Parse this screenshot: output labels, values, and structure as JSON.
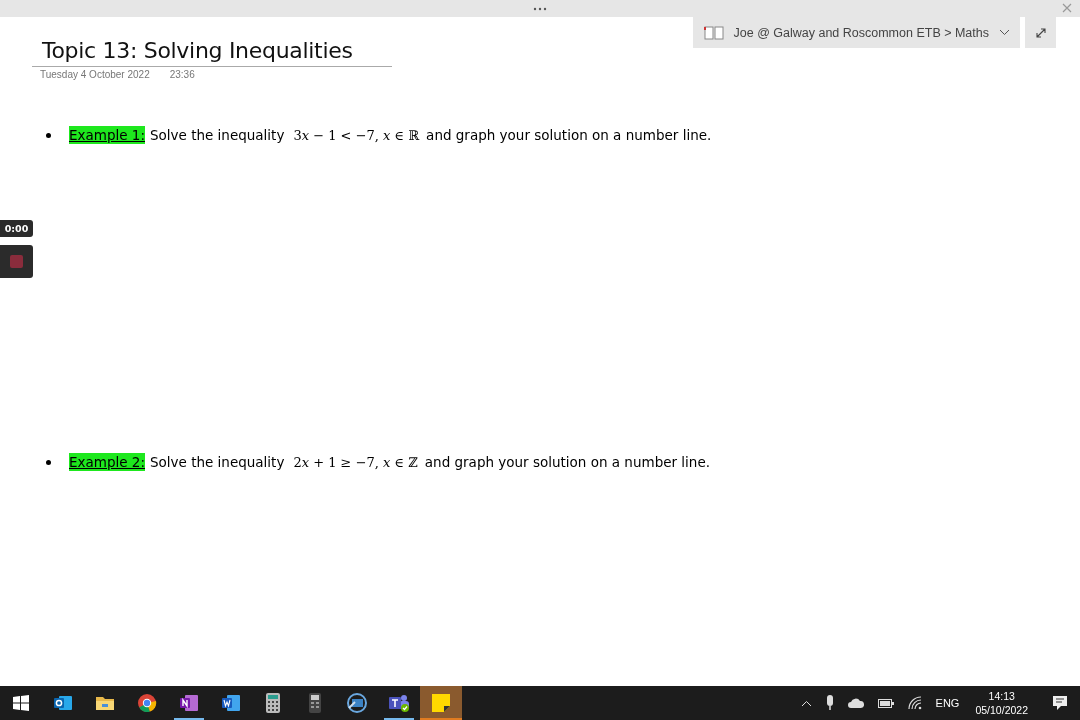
{
  "notebook_bar": {
    "path": "Joe @ Galway and Roscommon ETB > Maths"
  },
  "page": {
    "title": "Topic 13: Solving Inequalities",
    "date": "Tuesday 4 October 2022",
    "time": "23:36"
  },
  "examples": [
    {
      "label": "Example 1:",
      "text": "Solve the inequality",
      "coefficient": "3",
      "math": "*x* − 1 < −7, *x* ∈ ℝ",
      "tail": "and graph your solution on a number line."
    },
    {
      "label": "Example 2:",
      "text": "Solve the inequality",
      "coefficient": "2",
      "math": "*x* + 1 ≥ −7, *x* ∈ ℤ",
      "tail": "and graph your solution on a number line."
    }
  ],
  "recorder": {
    "time": "0:00"
  },
  "taskbar": {
    "apps": [
      {
        "kind": "start",
        "running": false,
        "selected": false
      },
      {
        "kind": "mail",
        "running": false,
        "selected": false
      },
      {
        "kind": "folder",
        "running": false,
        "selected": false
      },
      {
        "kind": "browser",
        "running": false,
        "selected": false
      },
      {
        "kind": "notes",
        "running": true,
        "selected": false
      },
      {
        "kind": "document",
        "running": false,
        "selected": false
      },
      {
        "kind": "calculator",
        "running": false,
        "selected": false
      },
      {
        "kind": "handheld-calculator",
        "running": false,
        "selected": false
      },
      {
        "kind": "remote",
        "running": false,
        "selected": false
      },
      {
        "kind": "team",
        "running": true,
        "selected": false
      },
      {
        "kind": "sticky-note",
        "running": true,
        "selected": true
      }
    ],
    "language": "ENG",
    "time": "14:13",
    "date": "05/10/2022"
  }
}
